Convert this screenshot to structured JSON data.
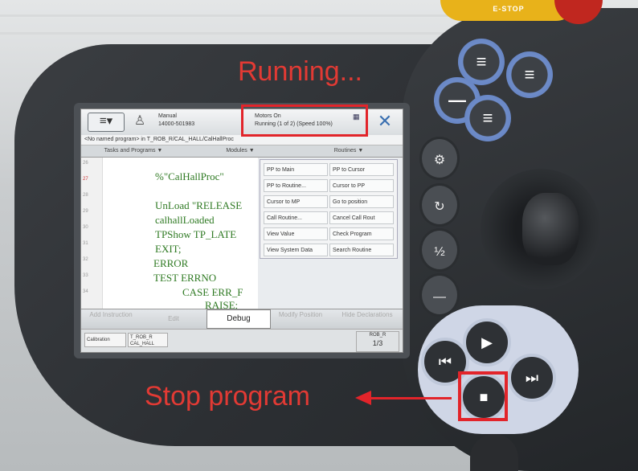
{
  "device": {
    "estop_label": "E-STOP"
  },
  "header": {
    "menu_icon": "hamburger-menu-icon",
    "mode_line1": "Manual",
    "mode_line2": "14000-501983",
    "status_line1": "Motors On",
    "status_line2": "Running (1 of 2) (Speed 100%)",
    "close_label": "✕"
  },
  "breadcrumb": "<No named program> in T_ROB_R/CAL_HALL/CalHallProc",
  "tabs": [
    "Tasks and Programs",
    "Modules",
    "Routines"
  ],
  "code": {
    "line_numbers": [
      "26",
      "27",
      "28",
      "29",
      "30",
      "31",
      "32",
      "33",
      "34"
    ],
    "lines": [
      "%\"CalHallProc\"",
      "UnLoad \"RELEASE",
      "calhallLoaded",
      "TPShow TP_LATE",
      "EXIT;",
      "ERROR",
      "TEST ERRNO",
      "CASE ERR_F",
      "RAISE;"
    ]
  },
  "debug_menu": {
    "items": [
      "PP to Main",
      "PP to Cursor",
      "PP to Routine...",
      "Cursor to PP",
      "Cursor to MP",
      "Go to position",
      "Call Routine...",
      "Cancel Call Rout",
      "View Value",
      "Check Program",
      "View System Data",
      "Search Routine"
    ]
  },
  "toolbar": {
    "add_instruction": "Add Instruction",
    "edit": "Edit",
    "debug": "Debug",
    "modify_position": "Modify Position",
    "hide_declarations": "Hide Declarations"
  },
  "taskbar": {
    "task1": "Calibration",
    "task2_line1": "T_ROB_R",
    "task2_line2": "CAL_HALL",
    "rob_label": "ROB_R",
    "rob_fraction": "1/3"
  },
  "annotations": {
    "running": "Running...",
    "stop": "Stop program"
  },
  "colors": {
    "annotation_red": "#e2242a",
    "code_green": "#2f7a23",
    "button_blue": "#5e7dbd"
  }
}
